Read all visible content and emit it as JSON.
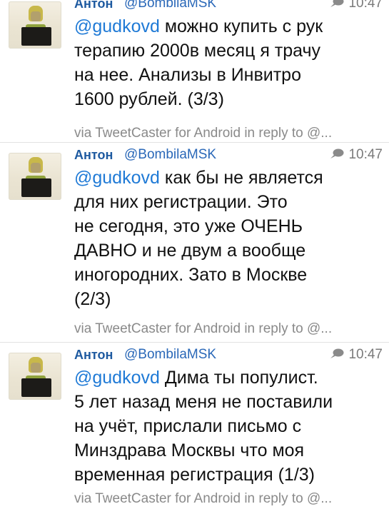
{
  "tweets": [
    {
      "author": "Антон",
      "handle": "@BombilaMSK",
      "time": "10:47",
      "mention": "@gudkovd",
      "text": " можно купить с рук\nтерапию 2000в месяц я трачу\nна нее. Анализы в Инвитро\n1600 рублей. (3/3)",
      "source": "via TweetCaster for Android in reply to @..."
    },
    {
      "author": "Антон",
      "handle": "@BombilaMSK",
      "time": "10:47",
      "mention": "@gudkovd",
      "text": " как бы не является\nдля них регистрации. Это\nне сегодня, это уже ОЧЕНЬ\nДАВНО и не двум а вообще\nиногородних. Зато в Москве\n(2/3)",
      "source": "via TweetCaster for Android in reply to @..."
    },
    {
      "author": "Антон",
      "handle": "@BombilaMSK",
      "time": "10:47",
      "mention": "@gudkovd",
      "text": " Дима ты популист.\n5 лет назад меня не поставили\nна учёт, прислали письмо с\nМинздрава Москвы что моя\nвременная регистрация (1/3)",
      "source": "via TweetCaster for Android in reply to @..."
    }
  ],
  "icons": {
    "avatar": "avatar-photo",
    "conversation": "conversation-bubble-icon"
  },
  "colors": {
    "author": "#1e5aa0",
    "handle": "#2a68b8",
    "mention": "#1f7ad6",
    "meta": "#8a8a8a"
  }
}
